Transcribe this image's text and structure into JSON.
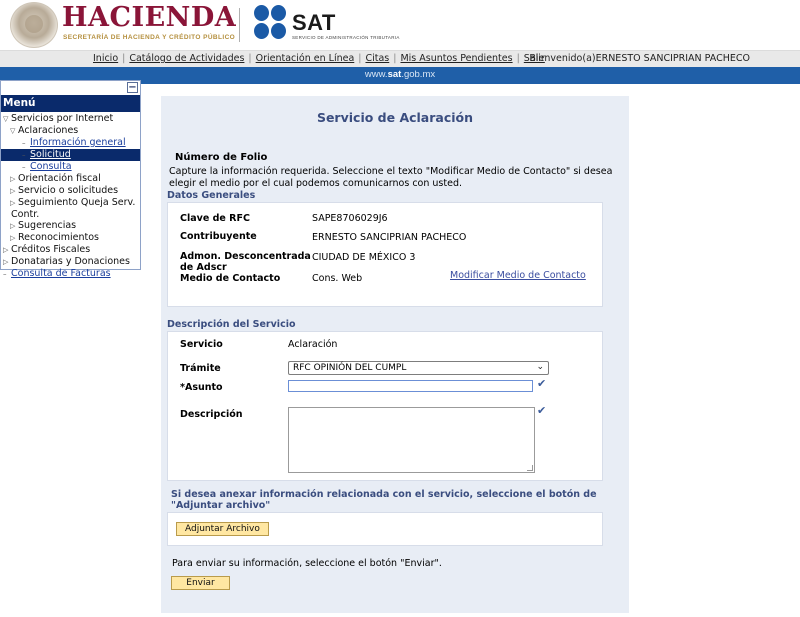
{
  "header": {
    "hacienda_title": "HACIENDA",
    "hacienda_subtitle": "SECRETARÍA DE HACIENDA Y CRÉDITO PÚBLICO",
    "sat_title": "SAT",
    "sat_subtitle": "SERVICIO DE ADMINISTRACIÓN TRIBUTARIA"
  },
  "topnav": {
    "links": [
      "Inicio",
      "Catálogo de Actividades",
      "Orientación en Línea",
      "Citas",
      "Mis Asuntos Pendientes",
      "Salir"
    ],
    "welcome": "Bienvenido(a)ERNESTO SANCIPRIAN PACHECO"
  },
  "site_bar": {
    "prefix": "www.",
    "brand": "sat",
    "suffix": ".gob.mx"
  },
  "sidebar": {
    "collapse_label": "−",
    "title": "Menú",
    "items": [
      {
        "label": "Servicios por Internet",
        "level": 0,
        "arrow": "▽",
        "link": false
      },
      {
        "label": "Aclaraciones",
        "level": 1,
        "arrow": "▽",
        "link": false
      },
      {
        "label": "Información general",
        "level": 2,
        "arrow": "–",
        "link": true
      },
      {
        "label": "Solicitud",
        "level": 2,
        "arrow": "–",
        "link": true,
        "selected": true
      },
      {
        "label": "Consulta",
        "level": 2,
        "arrow": "–",
        "link": true
      },
      {
        "label": "Orientación fiscal",
        "level": 1,
        "arrow": "▷",
        "link": false
      },
      {
        "label": "Servicio o solicitudes",
        "level": 1,
        "arrow": "▷",
        "link": false
      },
      {
        "label": "Seguimiento Queja Serv.",
        "level": 1,
        "arrow": "▷",
        "link": false
      },
      {
        "label": "Contr.",
        "level": 0,
        "arrow": "",
        "link": false
      },
      {
        "label": "Sugerencias",
        "level": 1,
        "arrow": "▷",
        "link": false
      },
      {
        "label": "Reconocimientos",
        "level": 1,
        "arrow": "▷",
        "link": false
      },
      {
        "label": "Créditos Fiscales",
        "level": 0,
        "arrow": "▷",
        "link": false
      },
      {
        "label": "Donatarias y Donaciones",
        "level": 0,
        "arrow": "▷",
        "link": false
      },
      {
        "label": "Consulta de Facturas",
        "level": 0,
        "arrow": "–",
        "link": true
      }
    ]
  },
  "main": {
    "title": "Servicio de Aclaración",
    "folio_label": "Número de Folio",
    "capture_text": "Capture la información requerida. Seleccione el texto \"Modificar Medio de Contacto\" si desea elegir el medio por el cual podemos comunicarnos con usted.",
    "datos_generales": {
      "title": "Datos Generales",
      "rfc_label": "Clave de RFC",
      "rfc_value": "SAPE8706029J6",
      "contribuyente_label": "Contribuyente",
      "contribuyente_value": "ERNESTO SANCIPRIAN PACHECO",
      "admon_label": "Admon. Desconcentrada de Adscr",
      "admon_value": "CIUDAD DE MÉXICO 3",
      "medio_label": "Medio de Contacto",
      "medio_value": "Cons. Web",
      "modificar_link": "Modificar Medio de Contacto"
    },
    "descripcion_servicio": {
      "title": "Descripción del Servicio",
      "servicio_label": "Servicio",
      "servicio_value": "Aclaración",
      "tramite_label": "Trámite",
      "tramite_value": "RFC OPINIÓN DEL CUMPL",
      "asunto_label": "*Asunto",
      "asunto_value": "",
      "descripcion_label": "Descripción",
      "descripcion_value": ""
    },
    "attach_text": "Si desea anexar información relacionada con el servicio, seleccione el botón de \"Adjuntar archivo\"",
    "attach_button": "Adjuntar Archivo",
    "send_text": "Para enviar su información, seleccione el botón \"Enviar\".",
    "send_button": "Enviar"
  }
}
